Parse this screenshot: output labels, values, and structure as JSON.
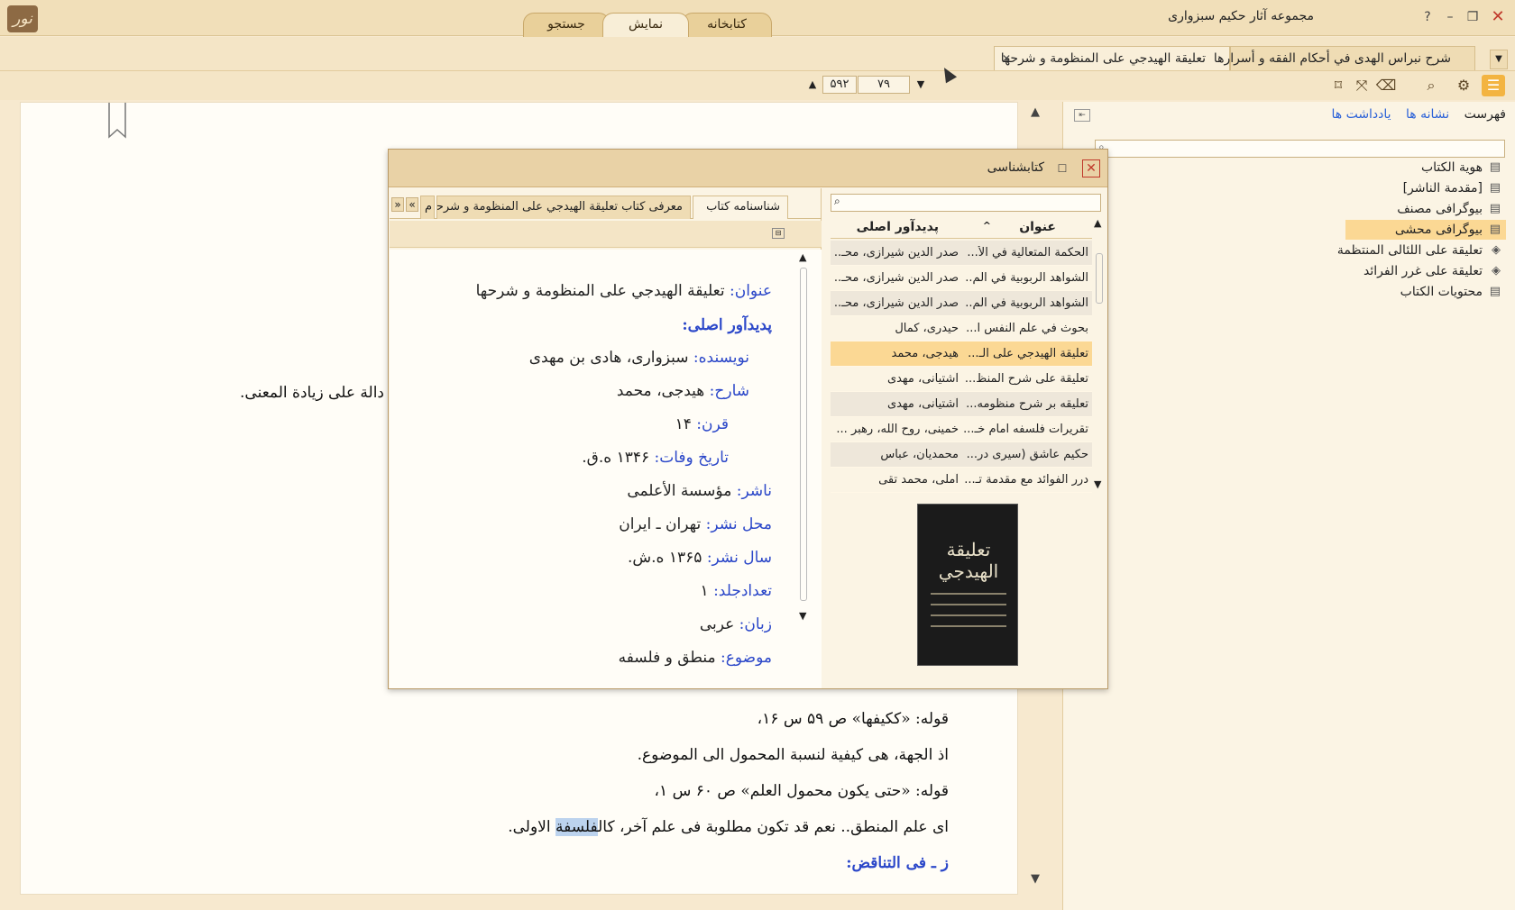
{
  "app": {
    "title": "مجموعه آثار حکیم سبزواری",
    "logo": "نور"
  },
  "main_tabs": [
    {
      "label": "کتابخانه"
    },
    {
      "label": "نمایش"
    },
    {
      "label": "جستجو"
    }
  ],
  "doc_tabs": [
    {
      "label": "شرح نبراس الهدى في أحكام الفقه و أسرارها"
    },
    {
      "label": "تعليقة الهيدجي على المنظومة و شرحها"
    }
  ],
  "pager": {
    "current_page": "۷۹",
    "total_pages": "۵۹۲"
  },
  "side_panel": {
    "tabs": [
      "فهرست",
      "نشانه ها",
      "یادداشت ها"
    ],
    "toc": [
      "هوية الكتاب",
      "[مقدمة الناشر]",
      "بیوگرافی مصنف",
      "بیوگرافی محشی",
      "تعليقة على اللئالى المنتظمة",
      "تعليقة على غرر الفرائد",
      "محتويات الكتاب"
    ]
  },
  "reader": {
    "lines": [
      "دالة على زيادة المعنى.",
      "قوله: «ككيفها» ص ۵۹ س ۱۶،",
      "اذ الجهة، هى كيفية لنسبة المحمول الى الموضوع.",
      "قوله: «حتى يكون محمول العلم» ص ۶۰ س ۱،",
      "اى علم المنطق.. نعم قد تكون مطلوبة فى علم آخر، كالفلسفة الاولى.",
      "ز ـ فى التناقض:"
    ]
  },
  "dialog": {
    "title": "کتابشناسی",
    "info_tabs": [
      "شناسنامه کتاب",
      "معرفی کتاب تعليقة الهيدجي على المنظومة و شرحها",
      "م"
    ],
    "info": {
      "title_label": "عنوان:",
      "title_value": "تعليقة الهيدجي على المنظومة و شرحها",
      "creator_heading": "پدیدآور اصلی:",
      "author_label": "نویسنده:",
      "author_value": "سبزواری، هادی بن مهدی",
      "commentator_label": "شارح:",
      "commentator_value": "هیدجی، محمد",
      "century_label": "قرن:",
      "century_value": "۱۴",
      "death_label": "تاریخ وفات:",
      "death_value": "۱۳۴۶ ه.ق.",
      "publisher_label": "ناشر:",
      "publisher_value": "مؤسسة الأعلمی",
      "place_label": "محل نشر:",
      "place_value": "تهران ـ ایران",
      "year_label": "سال نشر:",
      "year_value": "۱۳۶۵ ه.ش.",
      "volumes_label": "تعدادجلد:",
      "volumes_value": "۱",
      "language_label": "زبان:",
      "language_value": "عربی",
      "subject_label": "موضوع:",
      "subject_value": "منطق و فلسفه"
    },
    "list_headers": {
      "title": "عنوان",
      "creator": "پدیدآور اصلی"
    },
    "list": [
      {
        "title": "الحكمة المتعالية في الأ...",
        "creator": "صدر الدين شيرازى، محـ..."
      },
      {
        "title": "الشواهد الربوبية في الم...",
        "creator": "صدر الدين شيرازى، محـ..."
      },
      {
        "title": "الشواهد الربوبية في الم...",
        "creator": "صدر الدين شيرازى، محـ..."
      },
      {
        "title": "بحوث في علم النفس ا...",
        "creator": "حيدرى، كمال"
      },
      {
        "title": "تعليقة الهيدجي على الـ...",
        "creator": "هيدجى، محمد"
      },
      {
        "title": "تعليقة على شرح المنظ...",
        "creator": "آشتيانى، مهدى"
      },
      {
        "title": "تعليقه بر شرح منظومه...",
        "creator": "آشتيانى، مهدى"
      },
      {
        "title": "تقريرات فلسفه امام خـ...",
        "creator": "خمينى، روح الله، رهبر ..."
      },
      {
        "title": "حكيم عاشق (سيرى در...",
        "creator": "محمديان، عباس"
      },
      {
        "title": "درر الفوائد مع مقدمة تـ...",
        "creator": "آملى، محمد تقى"
      }
    ],
    "selected_index": 4,
    "cover_title": "تعليقة الهيدجي"
  },
  "colors": {
    "accent": "#f3b441",
    "link": "#2c62d8",
    "label": "#2c48c9",
    "selected": "#fbd894"
  }
}
